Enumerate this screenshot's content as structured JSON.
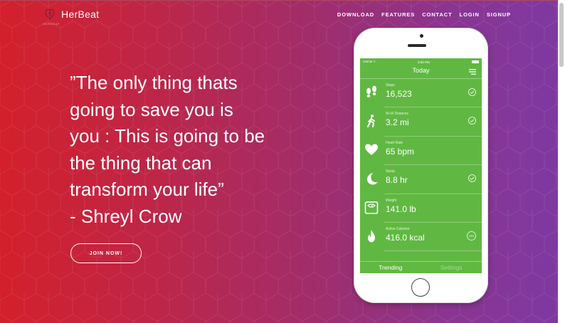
{
  "brand": {
    "name": "HerBeat",
    "tagline": "HERBEAT"
  },
  "nav": {
    "items": [
      "DOWNLOAD",
      "FEATURES",
      "CONTACT",
      "LOGIN",
      "SIGNUP"
    ]
  },
  "hero": {
    "quote_lines": [
      "”The only thing thats",
      "going to save you is",
      "you : This is going to be",
      "the thing that can",
      "transform your life”",
      "- Shreyl Crow"
    ],
    "cta_label": "JOIN NOW!"
  },
  "phone": {
    "status": {
      "carrier": "Carrier ☇",
      "time": "3:55 PM"
    },
    "title": "Today",
    "metrics": [
      {
        "label": "Steps",
        "value": "16,523",
        "icon": "footprints-icon",
        "status": "check"
      },
      {
        "label": "W+R Distance",
        "value": "3.2 mi",
        "icon": "walking-icon",
        "status": "check"
      },
      {
        "label": "Heart Rate",
        "value": "65 bpm",
        "icon": "heart-icon",
        "status": "none"
      },
      {
        "label": "Sleep",
        "value": "8.8 hr",
        "icon": "moon-icon",
        "status": "check"
      },
      {
        "label": "Weight",
        "value": "141.0 lb",
        "icon": "scale-icon",
        "status": "none"
      },
      {
        "label": "Active Calories",
        "value": "416.0 kcal",
        "icon": "flame-icon",
        "status": "percent",
        "badge": "49%"
      }
    ],
    "tabs": [
      "Trending",
      "Settings"
    ]
  },
  "colors": {
    "screen_green": "#60b842",
    "gradient_left": "#d3202b",
    "gradient_right": "#7d39a3"
  }
}
